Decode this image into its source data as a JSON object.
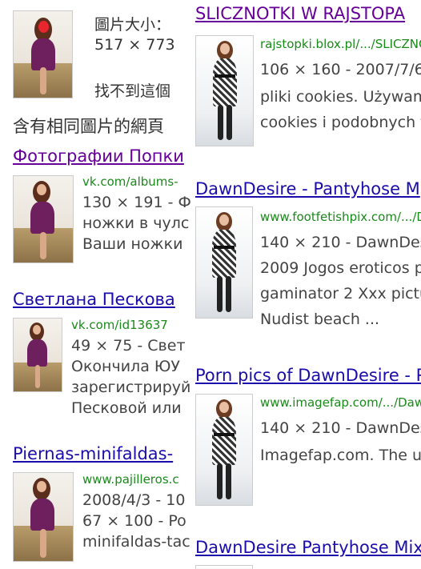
{
  "colors": {
    "link": "#1a0dab",
    "visited": "#660099",
    "url": "#1a8a1a",
    "text": "#444444"
  },
  "top": {
    "size_label": "圖片大小：",
    "size_value": "517 × 773",
    "not_found": "找不到這個",
    "section_heading": "含有相同圖片的網頁"
  },
  "left_results": [
    {
      "title": "Фотографии Попки",
      "url": "vk.com/albums-",
      "line1": "130 × 191 - Ф",
      "line2": "ножки в чулс",
      "line3": "Ваши ножки"
    },
    {
      "title": "Светлана Пескова",
      "url": "vk.com/id13637",
      "line1": "49 × 75 - Свет",
      "line2": "Окончила ЮУ",
      "line3": "зарегистрируй",
      "line4": "Песковой или"
    },
    {
      "title": "Piernas-minifaldas-",
      "url": "www.pajilleros.c",
      "line1": "2008/4/3 - 10",
      "line2": "67 × 100 - Po",
      "line3": "minifaldas-tac"
    }
  ],
  "right_results": [
    {
      "title": "SLICZNOTKI W RAJSTOPA",
      "url": "rajstopki.blox.pl/.../SLICZNO",
      "line1": "106 × 160 - 2007/7/6 - W",
      "line2": "pliki cookies. Używamy",
      "line3": "cookies i podobnych te"
    },
    {
      "title": "DawnDesire - Pantyhose M",
      "url": "www.footfetishpix.com/.../Da",
      "line1": "140 × 210 - DawnDesir",
      "line2": "2009 Jogos eroticos pa",
      "line3": "gaminator 2 Xxx picture",
      "line4": "Nudist beach ..."
    },
    {
      "title": "Porn pics of DawnDesire - P",
      "url": "www.imagefap.com/.../Dawn",
      "line1": "140 × 210 - DawnDesire",
      "line2": "Imagefap.com. The ulti"
    },
    {
      "title": "DawnDesire Pantyhose Mix"
    }
  ]
}
